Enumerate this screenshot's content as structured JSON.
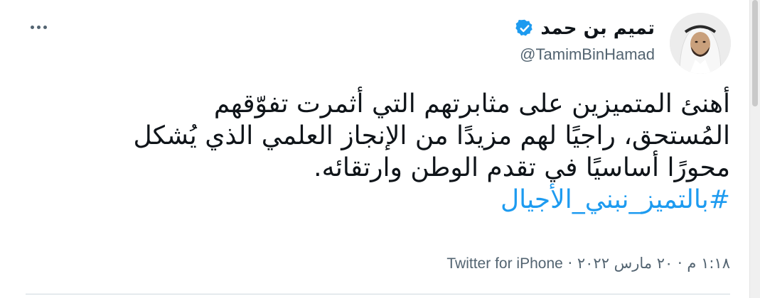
{
  "author": {
    "display_name": "تميم بن حمد",
    "handle": "@TamimBinHamad",
    "verified": true
  },
  "tweet": {
    "lines": [
      "أهنئ المتميزين على مثابرتهم التي أثمرت تفوّقهم",
      "المُستحق، راجيًا لهم مزيدًا من الإنجاز العلمي الذي يُشكل",
      "محورًا أساسيًا في تقدم الوطن وارتقائه."
    ],
    "hashtag": "#بالتميز_نبني_الأجيال"
  },
  "meta": {
    "time": "١:١٨ م",
    "separator": "·",
    "date": "٢٠ مارس ٢٠٢٢",
    "source": "Twitter for iPhone"
  },
  "colors": {
    "text": "#0f1419",
    "secondary": "#536471",
    "link": "#1d9bf0",
    "verified": "#1d9bf0"
  },
  "icons": {
    "verified": "verified-badge-icon",
    "more": "more-options-icon"
  }
}
